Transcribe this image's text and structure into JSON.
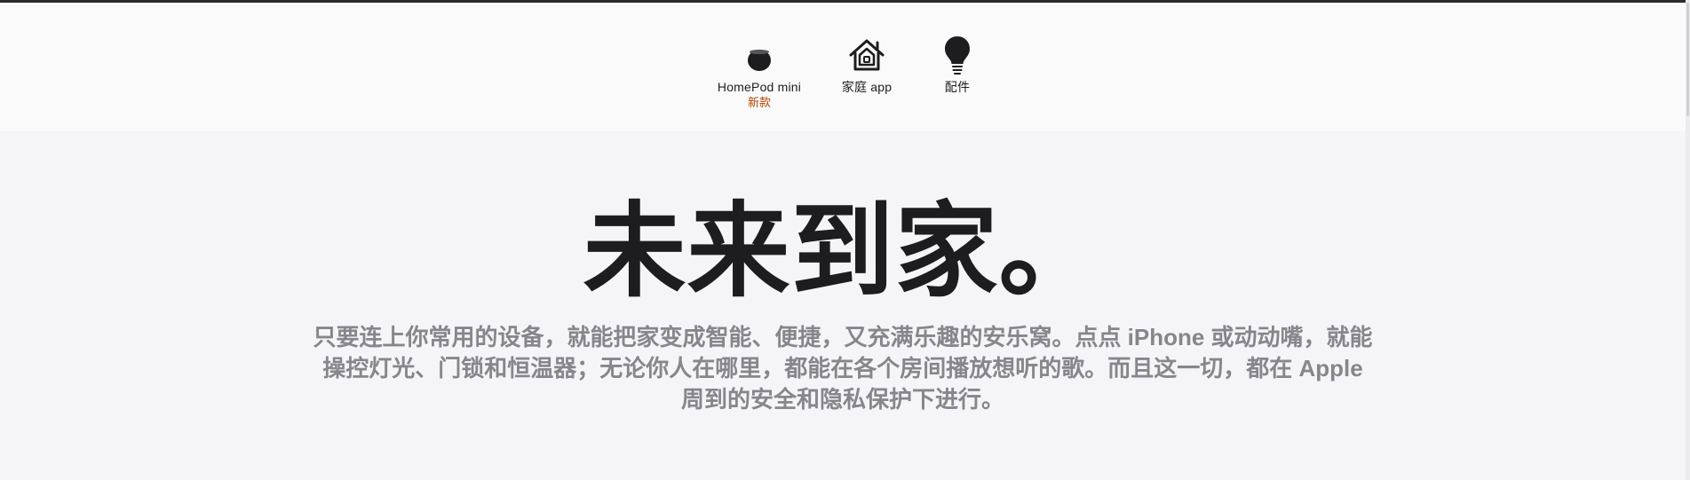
{
  "chapter_nav": {
    "items": [
      {
        "label": "HomePod mini",
        "badge": "新款",
        "icon": "homepod-mini-icon"
      },
      {
        "label": "家庭 app",
        "badge": "",
        "icon": "home-app-icon"
      },
      {
        "label": "配件",
        "badge": "",
        "icon": "lightbulb-icon"
      }
    ]
  },
  "hero": {
    "headline": "未来到家。",
    "body": "只要连上你常用的设备，就能把家变成智能、便捷，又充满乐趣的安乐窝。点点 iPhone 或动动嘴，就能操控灯光、门锁和恒温器；无论你人在哪里，都能在各个房间播放想听的歌。而且这一切，都在 Apple 周到的安全和隐私保护下进行。"
  },
  "colors": {
    "page_background": "#f5f5f7",
    "nav_background": "#fafafa",
    "headline_text": "#1d1d1f",
    "body_text": "#86868b",
    "badge_text": "#b64400"
  }
}
